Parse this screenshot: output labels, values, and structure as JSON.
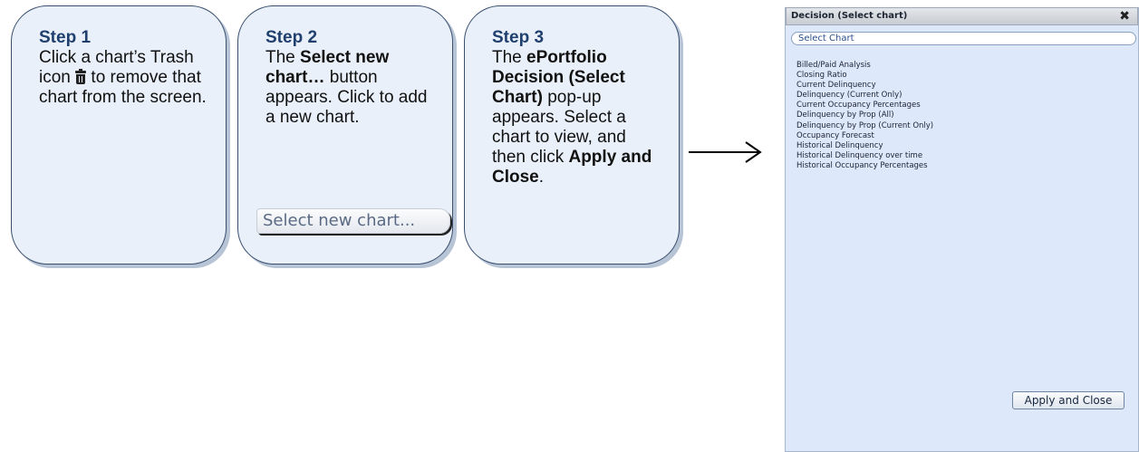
{
  "steps": [
    {
      "title": "Step 1",
      "line1": "Click a chart’s Trash icon ",
      "line2": " to remove that chart from the screen.",
      "trash_icon": "trash-icon"
    },
    {
      "title": "Step 2",
      "t1": "The ",
      "b1": "Select new chart…",
      "t2": " button appears. Click to add a new chart.",
      "button_label": "Select new chart..."
    },
    {
      "title": "Step 3",
      "t1": "The ",
      "b1": "ePortfolio Decision (Select Chart)",
      "t2": " pop-up appears. Select a chart to view, and then click ",
      "b2": "Apply and Close",
      "t3": "."
    }
  ],
  "popup": {
    "title": "Decision (Select chart)",
    "close_icon": "close-icon",
    "close_glyph": "✖",
    "select_field_value": "Select Chart",
    "chart_options": [
      "Billed/Paid Analysis",
      "Closing Ratio",
      "Current Delinquency",
      "Delinquency (Current Only)",
      "Current Occupancy Percentages",
      "Delinquency by Prop (All)",
      "Delinquency by Prop (Current Only)",
      "Occupancy Forecast",
      "Historical Delinquency",
      "Historical Delinquency over time",
      "Historical Occupancy Percentages"
    ],
    "apply_button_label": "Apply and Close"
  },
  "colors": {
    "card_background": "#e9f0fa",
    "card_border": "#3a4f6e",
    "step_title": "#1f3f6e",
    "popup_background": "#dde9fb"
  }
}
